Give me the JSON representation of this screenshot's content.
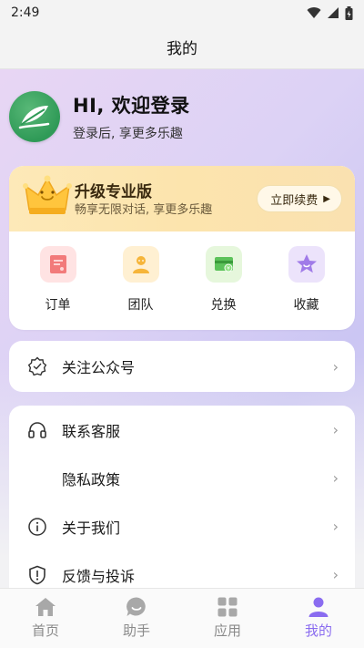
{
  "status_bar": {
    "time": "2:49"
  },
  "header": {
    "title": "我的"
  },
  "profile": {
    "greeting": "HI, 欢迎登录",
    "subtitle": "登录后, 享更多乐趣"
  },
  "vip": {
    "title": "升级专业版",
    "subtitle": "畅享无限对话, 享更多乐趣",
    "button_label": "立即续费"
  },
  "quick_actions": [
    {
      "label": "订单",
      "icon": "order-icon",
      "color": "#ffe3e3"
    },
    {
      "label": "团队",
      "icon": "team-icon",
      "color": "#fff0d2"
    },
    {
      "label": "兑换",
      "icon": "exchange-icon",
      "color": "#e6f7dc"
    },
    {
      "label": "收藏",
      "icon": "star-icon",
      "color": "#ece3fb"
    }
  ],
  "menu_follow": [
    {
      "label": "关注公众号",
      "icon": "badge-icon"
    }
  ],
  "menu_main": [
    {
      "label": "联系客服",
      "icon": "headset-icon"
    },
    {
      "label": "隐私政策",
      "icon": ""
    },
    {
      "label": "关于我们",
      "icon": "info-icon"
    },
    {
      "label": "反馈与投诉",
      "icon": "shield-icon"
    }
  ],
  "tabs": [
    {
      "label": "首页",
      "icon": "home-icon",
      "active": false
    },
    {
      "label": "助手",
      "icon": "assistant-icon",
      "active": false
    },
    {
      "label": "应用",
      "icon": "apps-icon",
      "active": false
    },
    {
      "label": "我的",
      "icon": "profile-icon",
      "active": true
    }
  ],
  "colors": {
    "accent": "#8a6cf0",
    "avatar": "#2f9a57"
  }
}
